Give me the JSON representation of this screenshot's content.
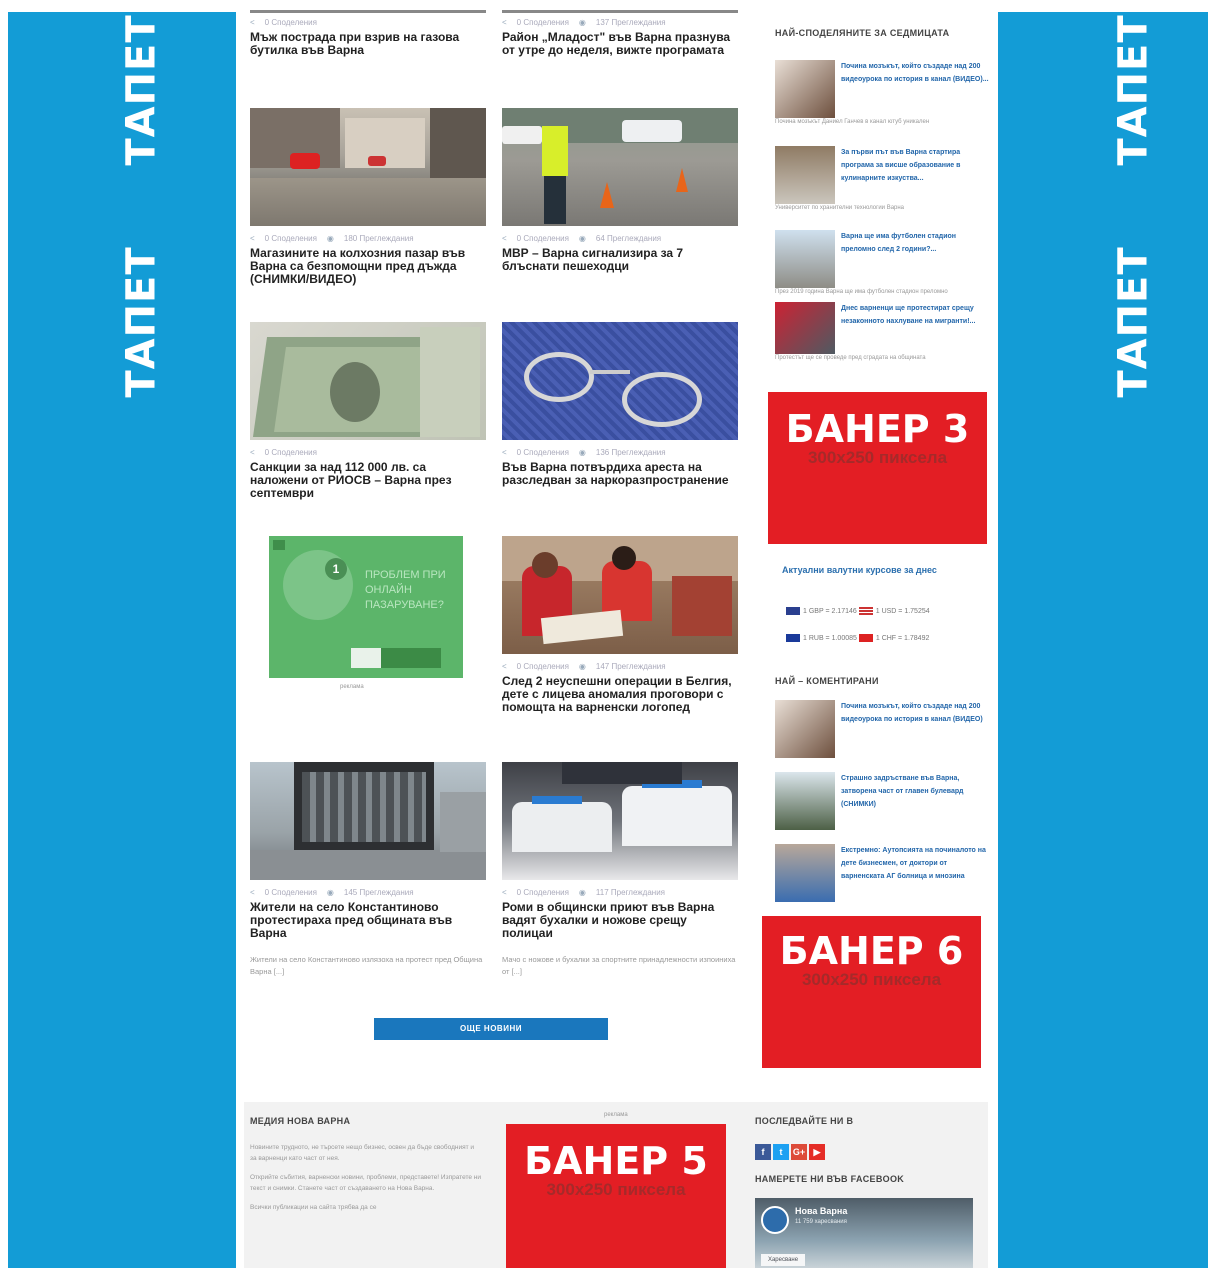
{
  "tapet_label": "ТАПЕТ",
  "articles": [
    {
      "meta1": "0 Споделения",
      "meta2": "",
      "title": "Мъж пострада при взрив на газова бутилка във Варна",
      "excerpt": ""
    },
    {
      "meta1": "0 Споделения",
      "meta2": "137 Преглеждания",
      "title": "Район „Младост\" във Варна празнува от утре до неделя, вижте програмата",
      "excerpt": ""
    },
    {
      "meta1": "0 Споделения",
      "meta2": "180 Преглеждания",
      "title": "Магазините на колхозния пазар във Варна са безпомощни пред дъжда (СНИМКИ/ВИДЕО)",
      "excerpt": ""
    },
    {
      "meta1": "0 Споделения",
      "meta2": "64 Преглеждания",
      "title": "МВР – Варна сигнализира за 7 блъснати пешеходци",
      "excerpt": ""
    },
    {
      "meta1": "0 Споделения",
      "meta2": "",
      "title": "Санкции за над 112 000 лв. са наложени от РИОСВ – Варна през септември",
      "excerpt": ""
    },
    {
      "meta1": "0 Споделения",
      "meta2": "136 Преглеждания",
      "title": "Във Варна потвърдиха ареста на разследван за наркоразпространение",
      "excerpt": ""
    },
    {
      "meta1": "0 Споделения",
      "meta2": "147 Преглеждания",
      "title": "След 2 неуспешни операции в Белгия, дете с лицева аномалия проговори с помощта на варненски логопед",
      "excerpt": ""
    },
    {
      "meta1": "0 Споделения",
      "meta2": "145 Преглеждания",
      "title": "Жители на село Константиново протестираха пред общината във Варна",
      "excerpt": "Жители на село Константиново излязоха на протест пред Община Варна [...]"
    },
    {
      "meta1": "0 Споделения",
      "meta2": "117 Преглеждания",
      "title": "Роми в общински приют във Варна вадят бухалки и ножове срещу полицаи",
      "excerpt": "Мачо с ножове и бухалки за спортните принадлежности изпоиниха от [...]"
    }
  ],
  "ad_box": {
    "text": "ПРОБЛЕМ ПРИ ОНЛАЙН ПАЗАРУВАНЕ?",
    "badge": "1",
    "caption": "реклама"
  },
  "more_button": "ОЩЕ НОВИНИ",
  "sidebar": {
    "popular_title": "НАЙ-СПОДЕЛЯНИТЕ ЗА СЕДМИЦАТА",
    "popular": [
      {
        "title": "Почина мозъкът, който създаде над 200 видеоурока по история в канал (ВИДЕО)...",
        "sub": "Почина мозъкът Даниел Ганчев в канал ютуб уникален"
      },
      {
        "title": "За първи път във Варна стартира програма за висше образование в кулинарните изкуства...",
        "sub": "Университет по хранителни технологии Варна"
      },
      {
        "title": "Варна ще има футболен стадион преломно след 2 години?...",
        "sub": "През 2019 година Варна ще има футболен стадион преломно"
      },
      {
        "title": "Днес варненци ще протестират срещу незаконното нахлуване на мигранти!...",
        "sub": "Протестът ще се проведе пред сградата на общината"
      }
    ],
    "banner3_big": "БАНЕР 3",
    "banner3_small": "300x250 пиксела",
    "currency_title": "Актуални валутни курсове за днес",
    "currency_row1_a": "1 GBP = 2.17146",
    "currency_row1_b": "1 USD = 1.75254",
    "currency_row2_a": "1 RUB = 1.00085",
    "currency_row2_b": "1 CHF = 1.78492",
    "commented_title": "НАЙ – КОМЕНТИРАНИ",
    "commented": [
      {
        "title": "Почина мозъкът, който създаде над 200 видеоурока по история в канал (ВИДЕО)"
      },
      {
        "title": "Страшно задръстване във Варна, затворена част от главен булевард (СНИМКИ)"
      },
      {
        "title": "Екстремно: Аутопсията на починалото на дете бизнесмен, от доктори от варненската АГ болница и мнозина"
      }
    ],
    "banner6_big": "БАНЕР 6",
    "banner6_small": "300x250 пиксела"
  },
  "footer": {
    "col1_title": "МЕДИЯ НОВА ВАРНА",
    "col1_p1": "Новините трудното, не търсете нещо бизнес, освен да бъде свободният и за варненци като част от нея.",
    "col1_p2": "Открийте събития, варненски новини, проблеми, представете! Изпратете ни текст и снимки. Станете част от създаването на Нова Варна.",
    "col1_p3": "Всички публикации на сайта трябва да се",
    "col2_caption": "реклама",
    "banner5_big": "БАНЕР 5",
    "banner5_small": "300x250 пиксела",
    "col3_title": "ПОСЛЕДВАЙТЕ НИ В",
    "social": [
      "f",
      "t",
      "G+",
      "▶"
    ],
    "fb_title": "НАМЕРЕТЕ НИ ВЪВ FACEBOOK",
    "fb_page_name": "Нова Варна",
    "fb_likes": "11 759 харесвания",
    "fb_like_btn": "Харесване"
  }
}
